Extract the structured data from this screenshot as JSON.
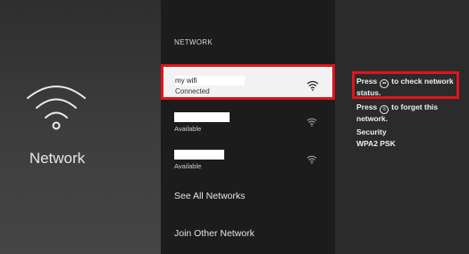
{
  "left": {
    "title": "Network",
    "icon": "wifi-icon"
  },
  "networks": {
    "section_label": "NETWORK",
    "selected": {
      "name": "my wifi",
      "status": "Connected"
    },
    "others": [
      {
        "name": "",
        "status": "Available"
      },
      {
        "name": "",
        "status": "Available"
      }
    ],
    "see_all": "See All Networks",
    "join_other": "Join Other Network"
  },
  "details": {
    "hint_check_pre": "Press",
    "hint_check_post": "to check network status.",
    "hint_forget_pre": "Press",
    "hint_forget_post": "to forget this network.",
    "security_label": "Security",
    "security_value": "WPA2 PSK"
  },
  "colors": {
    "highlight": "#e0141b",
    "selected_row_bg": "#f2f2f2",
    "middle_bg": "#1c1c1c"
  }
}
